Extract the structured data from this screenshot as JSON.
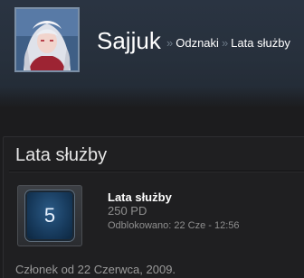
{
  "profile": {
    "persona_name": "Sajjuk",
    "breadcrumb": {
      "separator": "»",
      "items": [
        "Odznaki",
        "Lata służby"
      ]
    }
  },
  "badge_panel": {
    "title": "Lata służby",
    "badge": {
      "level": "5",
      "name": "Lata służby",
      "xp": "250 PD",
      "unlocked": "Odblokowano: 22 Cze - 12:56"
    },
    "member_since": "Członek od 22 Czerwca, 2009."
  },
  "colors": {
    "header_bg": "#27303c",
    "page_bg": "#1c1c1e",
    "badge_blue": "#2b5a86"
  }
}
